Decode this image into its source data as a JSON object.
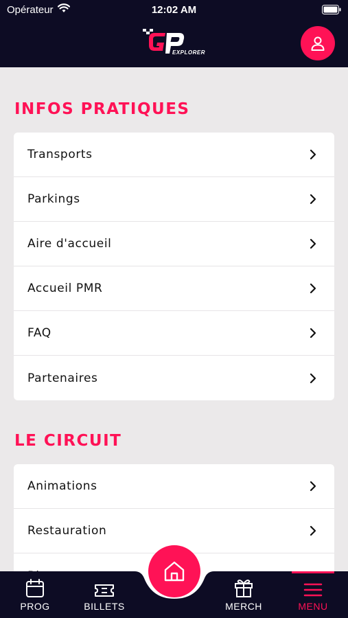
{
  "status_bar": {
    "carrier": "Opérateur",
    "time": "12:02 AM"
  },
  "header": {
    "logo_text": "EXPLORER"
  },
  "sections": [
    {
      "title": "INFOS PRATIQUES",
      "items": [
        {
          "label": "Transports"
        },
        {
          "label": "Parkings"
        },
        {
          "label": "Aire d'accueil"
        },
        {
          "label": "Accueil PMR"
        },
        {
          "label": "FAQ"
        },
        {
          "label": "Partenaires"
        }
      ]
    },
    {
      "title": "LE CIRCUIT",
      "items": [
        {
          "label": "Animations"
        },
        {
          "label": "Restauration"
        },
        {
          "label": "Bl..."
        }
      ]
    }
  ],
  "tabbar": {
    "prog": "PROG",
    "billets": "BILLETS",
    "merch": "MERCH",
    "menu": "MENU",
    "active": "menu"
  },
  "colors": {
    "accent": "#ff1256",
    "header_bg": "#0d0c24",
    "page_bg": "#ebe9ea"
  }
}
